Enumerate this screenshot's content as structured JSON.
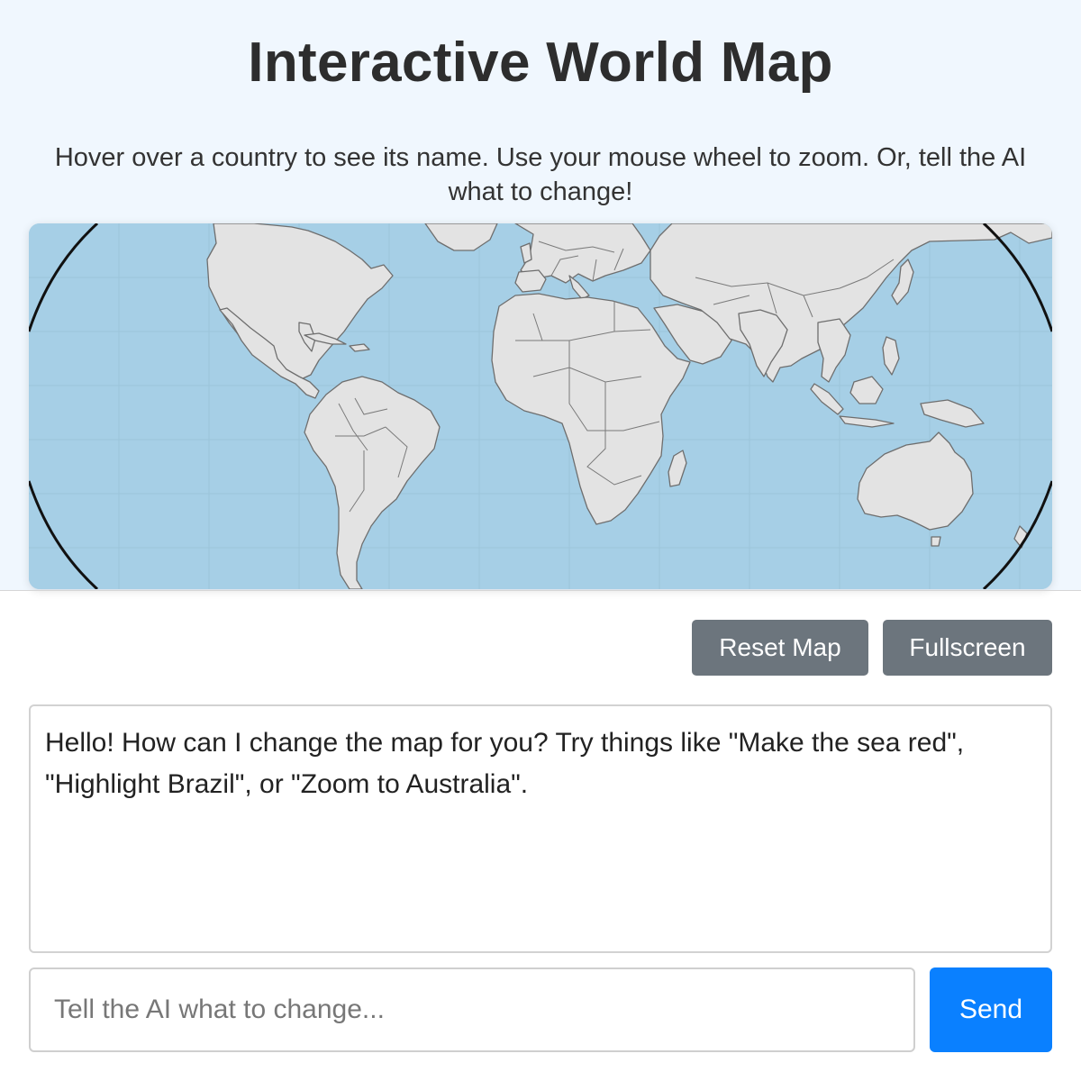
{
  "header": {
    "title": "Interactive World Map",
    "subtitle": "Hover over a country to see its name. Use your mouse wheel to zoom. Or, tell the AI what to change!"
  },
  "map": {
    "ocean_color": "#a6cfe6",
    "land_color": "#e3e3e3",
    "border_color": "#6e6e6e"
  },
  "controls": {
    "reset_label": "Reset Map",
    "fullscreen_label": "Fullscreen",
    "button_color": "#6c757d"
  },
  "chat": {
    "messages": [
      {
        "sender": "ai",
        "text": "Hello! How can I change the map for you? Try things like \"Make the sea red\", \"Highlight Brazil\", or \"Zoom to Australia\"."
      }
    ],
    "input_placeholder": "Tell the AI what to change...",
    "input_value": "",
    "send_label": "Send",
    "send_color": "#0a80ff"
  }
}
